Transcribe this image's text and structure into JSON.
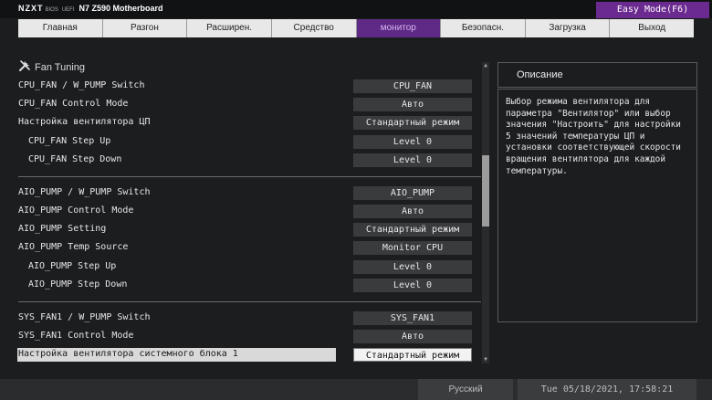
{
  "header": {
    "brand_logo": "NZXT",
    "brand_bios": "BIOS",
    "brand_uefi": "UEFI",
    "board": "N7 Z590 Motherboard",
    "easy_mode": "Easy Mode(F6)"
  },
  "tabs": [
    {
      "label": "Главная"
    },
    {
      "label": "Разгон"
    },
    {
      "label": "Расширен."
    },
    {
      "label": "Средство"
    },
    {
      "label": "монитор",
      "active": true
    },
    {
      "label": "Безопасн."
    },
    {
      "label": "Загрузка"
    },
    {
      "label": "Выход"
    }
  ],
  "section": {
    "title": "Fan Tuning",
    "icon": "tools-icon"
  },
  "rows": [
    {
      "label": "CPU_FAN / W_PUMP Switch",
      "value": "CPU_FAN"
    },
    {
      "label": "CPU_FAN Control Mode",
      "value": "Авто"
    },
    {
      "label": "Настройка вентилятора ЦП",
      "value": "Стандартный режим"
    },
    {
      "label": "CPU_FAN Step Up",
      "value": "Level 0"
    },
    {
      "label": "CPU_FAN Step Down",
      "value": "Level 0"
    },
    {
      "label": "AIO_PUMP / W_PUMP Switch",
      "value": "AIO_PUMP"
    },
    {
      "label": "AIO_PUMP Control Mode",
      "value": "Авто"
    },
    {
      "label": "AIO_PUMP Setting",
      "value": "Стандартный режим"
    },
    {
      "label": "AIO_PUMP Temp Source",
      "value": "Monitor CPU"
    },
    {
      "label": "AIO_PUMP Step Up",
      "value": "Level 0"
    },
    {
      "label": "AIO_PUMP Step Down",
      "value": "Level 0"
    },
    {
      "label": "SYS_FAN1 / W_PUMP Switch",
      "value": "SYS_FAN1"
    },
    {
      "label": "SYS_FAN1 Control Mode",
      "value": "Авто"
    },
    {
      "label": "Настройка вентилятора системного блока 1",
      "value": "Стандартный режим"
    }
  ],
  "description": {
    "title": "Описание",
    "text": "Выбор режима вентилятора для параметра \"Вентилятор\" или выбор значения \"Настроить\" для настройки 5 значений температуры ЦП и установки соответствующей скорости вращения вентилятора для каждой температуры."
  },
  "footer": {
    "language": "Русский",
    "datetime": "Tue 05/18/2021, 17:58:21"
  }
}
